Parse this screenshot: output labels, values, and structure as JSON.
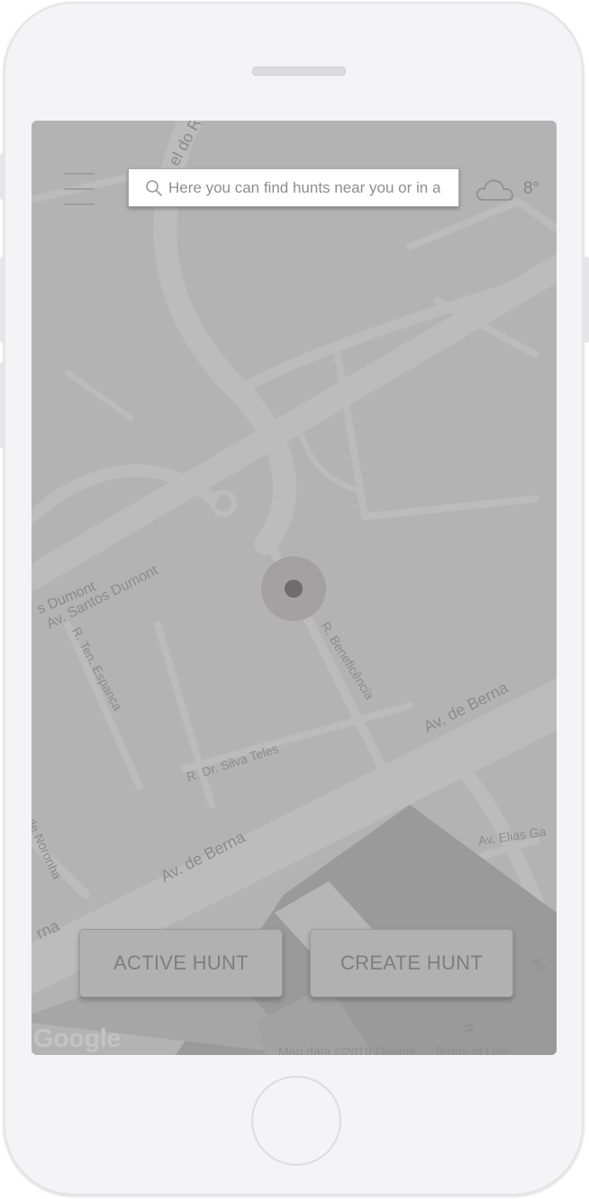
{
  "search": {
    "placeholder": "Here you can find hunts near you or in a"
  },
  "weather": {
    "icon": "cloud-icon",
    "temperature": "8°"
  },
  "map": {
    "streets": [
      {
        "id": "s-santos-dumont-1",
        "text": "s Dumont"
      },
      {
        "id": "s-santos-dumont-2",
        "text": "Av. Santos Dumont"
      },
      {
        "id": "s-ten-espanca",
        "text": "R. Ten. Espanca"
      },
      {
        "id": "s-beneficencia",
        "text": "R. Beneficência"
      },
      {
        "id": "s-de-berna-top",
        "text": "Av. de Berna"
      },
      {
        "id": "s-silva-teles",
        "text": "R. Dr. Silva Teles"
      },
      {
        "id": "s-de-berna-low",
        "text": "Av. de Berna"
      },
      {
        "id": "s-noronha",
        "text": "de Noronha"
      },
      {
        "id": "s-rna",
        "text": "rna"
      },
      {
        "id": "s-elias",
        "text": "Av. Elias Ga"
      },
      {
        "id": "s-av-right",
        "text": "Av."
      },
      {
        "id": "s-r-bottom",
        "text": "R."
      },
      {
        "id": "s-top",
        "text": "el do R"
      }
    ],
    "google_logo": "Google",
    "attribution": {
      "map_data": "Map data ©2019 Google",
      "terms": "Terms of Use"
    }
  },
  "buttons": {
    "active_hunt": "ACTIVE HUNT",
    "create_hunt": "CREATE HUNT"
  },
  "colors": {
    "map_background": "#b3b3b3",
    "road": "#bcbcbc",
    "location_ring": "#a3a1a2",
    "location_dot": "#6e6c6d"
  }
}
